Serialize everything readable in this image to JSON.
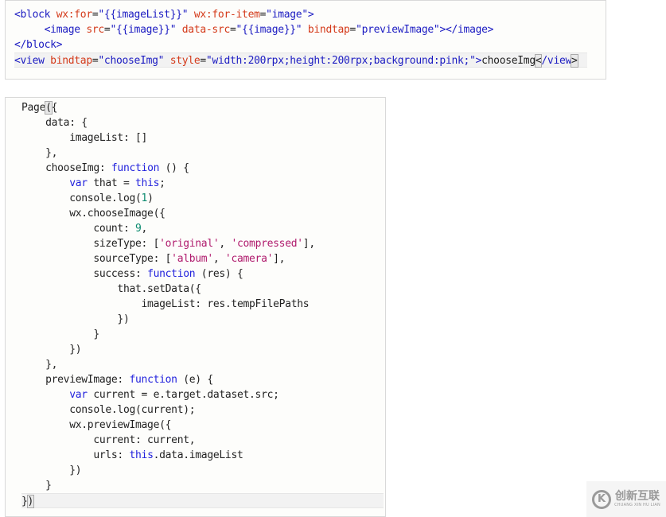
{
  "wxml_snippet": {
    "lines": [
      [
        [
          "tag",
          "<block "
        ],
        [
          "attr",
          "wx:for"
        ],
        [
          "plain",
          "="
        ],
        [
          "str",
          "\"{{imageList}}\""
        ],
        [
          "plain",
          " "
        ],
        [
          "attr",
          "wx:for-item"
        ],
        [
          "plain",
          "="
        ],
        [
          "str",
          "\"image\""
        ],
        [
          "tag",
          ">"
        ]
      ],
      [
        [
          "plain",
          "     "
        ],
        [
          "tag",
          "<image "
        ],
        [
          "attr",
          "src"
        ],
        [
          "plain",
          "="
        ],
        [
          "str",
          "\"{{image}}\""
        ],
        [
          "plain",
          " "
        ],
        [
          "attr",
          "data-src"
        ],
        [
          "plain",
          "="
        ],
        [
          "str",
          "\"{{image}}\""
        ],
        [
          "plain",
          " "
        ],
        [
          "attr",
          "bindtap"
        ],
        [
          "plain",
          "="
        ],
        [
          "str",
          "\"previewImage\""
        ],
        [
          "tag",
          "></image>"
        ]
      ],
      [
        [
          "tag",
          "</block>"
        ]
      ],
      [
        [
          "tag",
          "<view "
        ],
        [
          "attr",
          "bindtap"
        ],
        [
          "plain",
          "="
        ],
        [
          "str",
          "\"chooseImg\""
        ],
        [
          "plain",
          " "
        ],
        [
          "attr",
          "style"
        ],
        [
          "plain",
          "="
        ],
        [
          "str",
          "\"width:200rpx;height:200rpx;background:pink;\""
        ],
        [
          "tag",
          ">"
        ],
        [
          "plain",
          "chooseImg"
        ],
        [
          "brk",
          "<"
        ],
        [
          "tag",
          "/view"
        ],
        [
          "brk",
          ">"
        ]
      ]
    ]
  },
  "js_snippet": {
    "lines": [
      [
        [
          "plain",
          "Page"
        ],
        [
          "brk",
          "("
        ],
        [
          "plain",
          "{"
        ]
      ],
      [
        [
          "plain",
          "    data: {"
        ]
      ],
      [
        [
          "plain",
          "        imageList: []"
        ]
      ],
      [
        [
          "plain",
          "    },"
        ]
      ],
      [
        [
          "plain",
          "    chooseImg: "
        ],
        [
          "kw",
          "function"
        ],
        [
          "plain",
          " () {"
        ]
      ],
      [
        [
          "plain",
          "        "
        ],
        [
          "kw",
          "var"
        ],
        [
          "plain",
          " that = "
        ],
        [
          "kw",
          "this"
        ],
        [
          "plain",
          ";"
        ]
      ],
      [
        [
          "plain",
          "        console.log("
        ],
        [
          "num",
          "1"
        ],
        [
          "plain",
          ")"
        ]
      ],
      [
        [
          "plain",
          "        wx.chooseImage({"
        ]
      ],
      [
        [
          "plain",
          "            count: "
        ],
        [
          "num",
          "9"
        ],
        [
          "plain",
          ","
        ]
      ],
      [
        [
          "plain",
          "            sizeType: ["
        ],
        [
          "sq",
          "'original'"
        ],
        [
          "plain",
          ", "
        ],
        [
          "sq",
          "'compressed'"
        ],
        [
          "plain",
          "],"
        ]
      ],
      [
        [
          "plain",
          "            sourceType: ["
        ],
        [
          "sq",
          "'album'"
        ],
        [
          "plain",
          ", "
        ],
        [
          "sq",
          "'camera'"
        ],
        [
          "plain",
          "],"
        ]
      ],
      [
        [
          "plain",
          "            success: "
        ],
        [
          "kw",
          "function"
        ],
        [
          "plain",
          " (res) {"
        ]
      ],
      [
        [
          "plain",
          "                that.setData({"
        ]
      ],
      [
        [
          "plain",
          "                    imageList: res.tempFilePaths"
        ]
      ],
      [
        [
          "plain",
          "                })"
        ]
      ],
      [
        [
          "plain",
          "            }"
        ]
      ],
      [
        [
          "plain",
          "        })"
        ]
      ],
      [
        [
          "plain",
          "    },"
        ]
      ],
      [
        [
          "plain",
          "    previewImage: "
        ],
        [
          "kw",
          "function"
        ],
        [
          "plain",
          " (e) {"
        ]
      ],
      [
        [
          "plain",
          "        "
        ],
        [
          "kw",
          "var"
        ],
        [
          "plain",
          " current = e.target.dataset.src;"
        ]
      ],
      [
        [
          "plain",
          "        console.log(current);"
        ]
      ],
      [
        [
          "plain",
          "        wx.previewImage({"
        ]
      ],
      [
        [
          "plain",
          "            current: current,"
        ]
      ],
      [
        [
          "plain",
          "            urls: "
        ],
        [
          "kw",
          "this"
        ],
        [
          "plain",
          ".data.imageList"
        ]
      ],
      [
        [
          "plain",
          "        })"
        ]
      ],
      [
        [
          "plain",
          "    }"
        ]
      ],
      [
        [
          "plain",
          "}"
        ],
        [
          "brk",
          ")"
        ]
      ]
    ]
  },
  "watermark": {
    "icon": "chuangxin-logo-icon",
    "mark": "K",
    "title": "创新互联",
    "subtitle": "CHUANG XIN HU LIAN"
  }
}
